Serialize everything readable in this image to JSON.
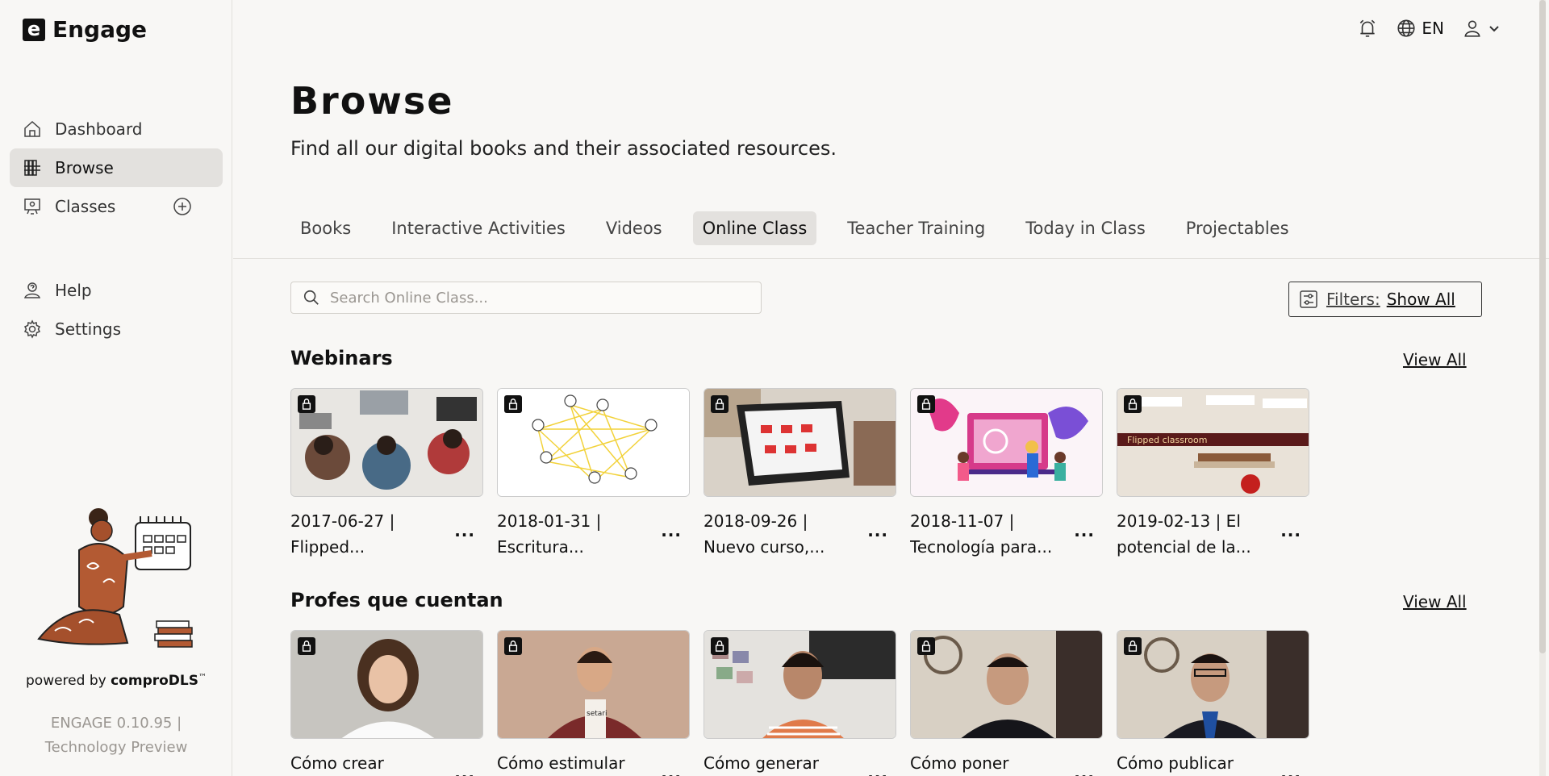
{
  "app": {
    "logo_mark": "e",
    "name": "Engage"
  },
  "sidebar": {
    "items": [
      {
        "label": "Dashboard",
        "icon": "home-icon",
        "active": false
      },
      {
        "label": "Browse",
        "icon": "browse-icon",
        "active": true
      },
      {
        "label": "Classes",
        "icon": "classes-icon",
        "active": false
      }
    ],
    "secondary": [
      {
        "label": "Help",
        "icon": "help-icon"
      },
      {
        "label": "Settings",
        "icon": "gear-icon"
      }
    ],
    "powered_prefix": "powered by",
    "powered_brand": "comproDLS",
    "powered_tm": "™",
    "version_line1": "ENGAGE 0.10.95 |",
    "version_line2": "Technology Preview"
  },
  "topbar": {
    "language": "EN"
  },
  "page": {
    "title": "Browse",
    "subtitle": "Find all our digital books and their associated resources."
  },
  "tabs": [
    {
      "label": "Books",
      "active": false
    },
    {
      "label": "Interactive Activities",
      "active": false
    },
    {
      "label": "Videos",
      "active": false
    },
    {
      "label": "Online Class",
      "active": true
    },
    {
      "label": "Teacher Training",
      "active": false
    },
    {
      "label": "Today in Class",
      "active": false
    },
    {
      "label": "Projectables",
      "active": false
    }
  ],
  "search": {
    "placeholder": "Search Online Class...",
    "value": ""
  },
  "filters": {
    "label": "Filters:",
    "value": "Show All"
  },
  "sections": [
    {
      "title": "Webinars",
      "view_all": "View All",
      "cards": [
        {
          "line1": "2017-06-27 |",
          "line2": "Flipped..."
        },
        {
          "line1": "2018-01-31 |",
          "line2": "Escritura..."
        },
        {
          "line1": "2018-09-26 |",
          "line2": "Nuevo curso,..."
        },
        {
          "line1": "2018-11-07 |",
          "line2": "Tecnología para..."
        },
        {
          "line1": "2019-02-13 | El",
          "line2": "potencial de la..."
        }
      ]
    },
    {
      "title": "Profes que cuentan",
      "view_all": "View All",
      "cards": [
        {
          "line1": "Cómo crear",
          "line2": ""
        },
        {
          "line1": "Cómo estimular",
          "line2": ""
        },
        {
          "line1": "Cómo generar",
          "line2": ""
        },
        {
          "line1": "Cómo poner",
          "line2": ""
        },
        {
          "line1": "Cómo publicar",
          "line2": ""
        }
      ]
    }
  ],
  "more_label": "...",
  "thumb_label": "Flipped classroom",
  "thumb_label_2": "setari"
}
